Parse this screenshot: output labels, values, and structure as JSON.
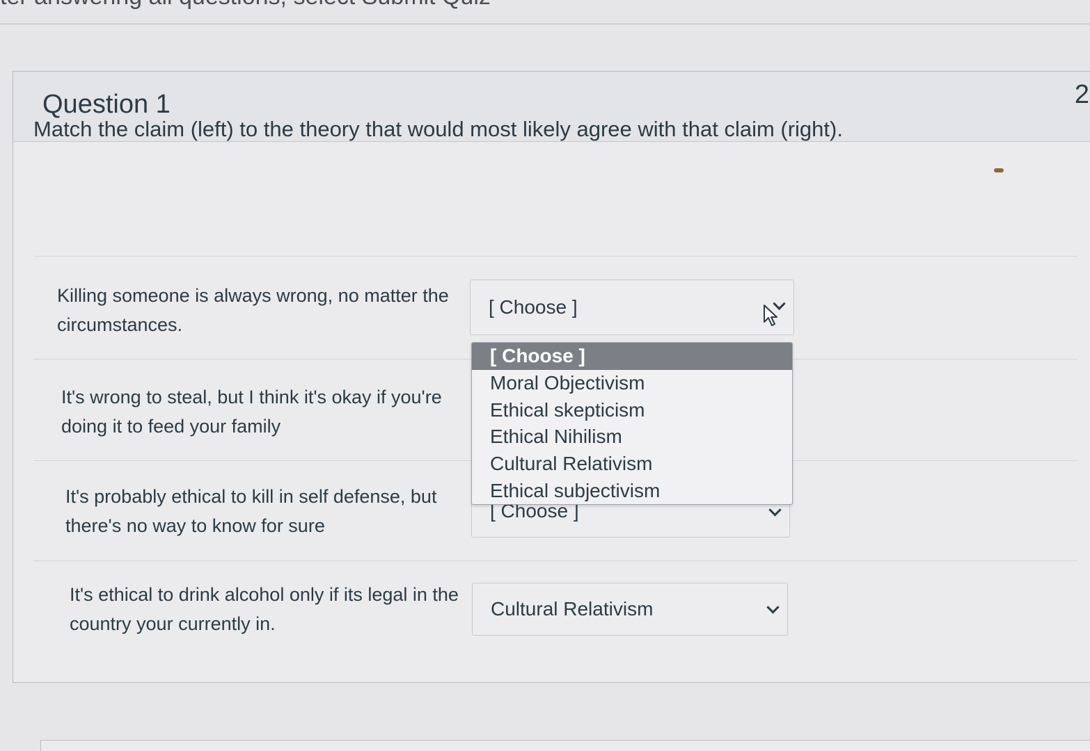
{
  "header": {
    "top_text": "ter answering all questions, select Submit Quiz"
  },
  "question": {
    "title": "Question 1",
    "points": "2",
    "prompt": "Match the claim (left) to the theory that would most likely agree with that claim (right)."
  },
  "rows": [
    {
      "claim": "Killing someone is always wrong, no matter the circumstances.",
      "selected": "[ Choose ]"
    },
    {
      "claim": "It's wrong to steal, but I think it's okay if you're doing it to feed your family",
      "selected": ""
    },
    {
      "claim": "It's probably ethical to kill in self defense, but there's no way to know for sure",
      "selected": "[ Choose ]"
    },
    {
      "claim": "It's ethical to drink alcohol only if its legal in the country your currently in.",
      "selected": "Cultural Relativism"
    }
  ],
  "dropdown": {
    "options": [
      "[ Choose ]",
      "Moral Objectivism",
      "Ethical skepticism",
      "Ethical Nihilism",
      "Cultural Relativism",
      "Ethical subjectivism"
    ],
    "highlighted_index": 0
  },
  "colors": {
    "highlight": "#7c7f86",
    "text": "#2d3b45",
    "background": "#e6e6e9"
  }
}
